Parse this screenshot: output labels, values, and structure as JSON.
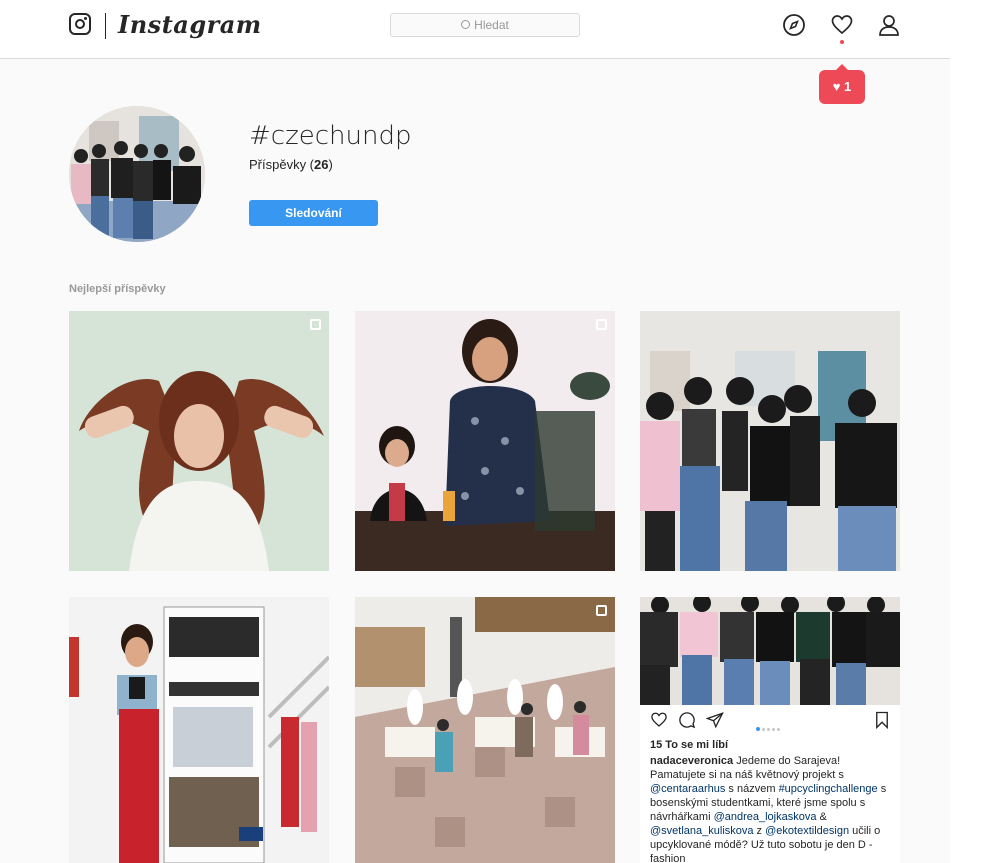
{
  "app": {
    "logo_text": "Instagram"
  },
  "search": {
    "placeholder": "Hledat"
  },
  "nav": {
    "icons": [
      "compass-icon",
      "heart-icon",
      "profile-icon"
    ]
  },
  "notification": {
    "count": "1",
    "accent": "#ed4956"
  },
  "hashtag": {
    "title": "#czechundp",
    "posts_label": "Příspěvky (",
    "posts_count": "26",
    "posts_close": ")",
    "follow_label": "Sledování"
  },
  "section": {
    "top_posts_label": "Nejlepší příspěvky"
  },
  "posts": [
    {
      "kind": "portrait-hair",
      "multi": true
    },
    {
      "kind": "speaker",
      "multi": true
    },
    {
      "kind": "group-poster",
      "multi": false
    },
    {
      "kind": "rollup-banner",
      "multi": false
    },
    {
      "kind": "workshop",
      "multi": true
    },
    {
      "kind": "embedded-post",
      "multi": false
    }
  ],
  "embedded_post": {
    "likes": "15 To se mi líbí",
    "user": "nadaceveronica",
    "caption_1": " Jedeme do Sarajeva! Pamatujete si na náš květnový projekt s ",
    "mention_1": "@centaraarhus",
    "caption_2": " s názvem ",
    "mention_2": "#upcyclingchallenge",
    "caption_3": " s bosenskými studentkami, které jsme spolu s návrhářkami ",
    "mention_3": "@andrea_lojkaskova",
    "caption_4": " & ",
    "mention_4": "@svetlana_kuliskova",
    "caption_5": " z ",
    "mention_5": "@ekotextildesign",
    "caption_6": " učili o upcyklované módě? Už tuto sobotu je den D - fashion"
  },
  "colors": {
    "accent_blue": "#3897f0",
    "border": "#dbdbdb",
    "background": "#fafafa"
  }
}
